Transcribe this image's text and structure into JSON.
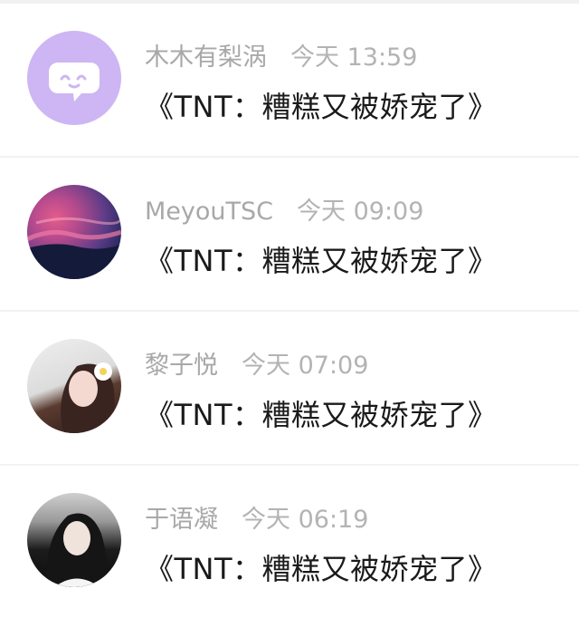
{
  "messages": [
    {
      "username": "木木有梨涡",
      "time": "今天 13:59",
      "message": "《TNT：糟糕又被娇宠了》",
      "avatar_icon": "chat-bubble-icon"
    },
    {
      "username": "MeyouTSC",
      "time": "今天 09:09",
      "message": "《TNT：糟糕又被娇宠了》",
      "avatar_icon": "sky-photo"
    },
    {
      "username": "黎子悦",
      "time": "今天 07:09",
      "message": "《TNT：糟糕又被娇宠了》",
      "avatar_icon": "portrait-photo"
    },
    {
      "username": "于语凝",
      "time": "今天 06:19",
      "message": "《TNT：糟糕又被娇宠了》",
      "avatar_icon": "portrait-photo"
    }
  ],
  "colors": {
    "avatar_purple": "#cdb6f3",
    "name_gray": "#a8a8a8",
    "text_dark": "#1a1a1a"
  }
}
